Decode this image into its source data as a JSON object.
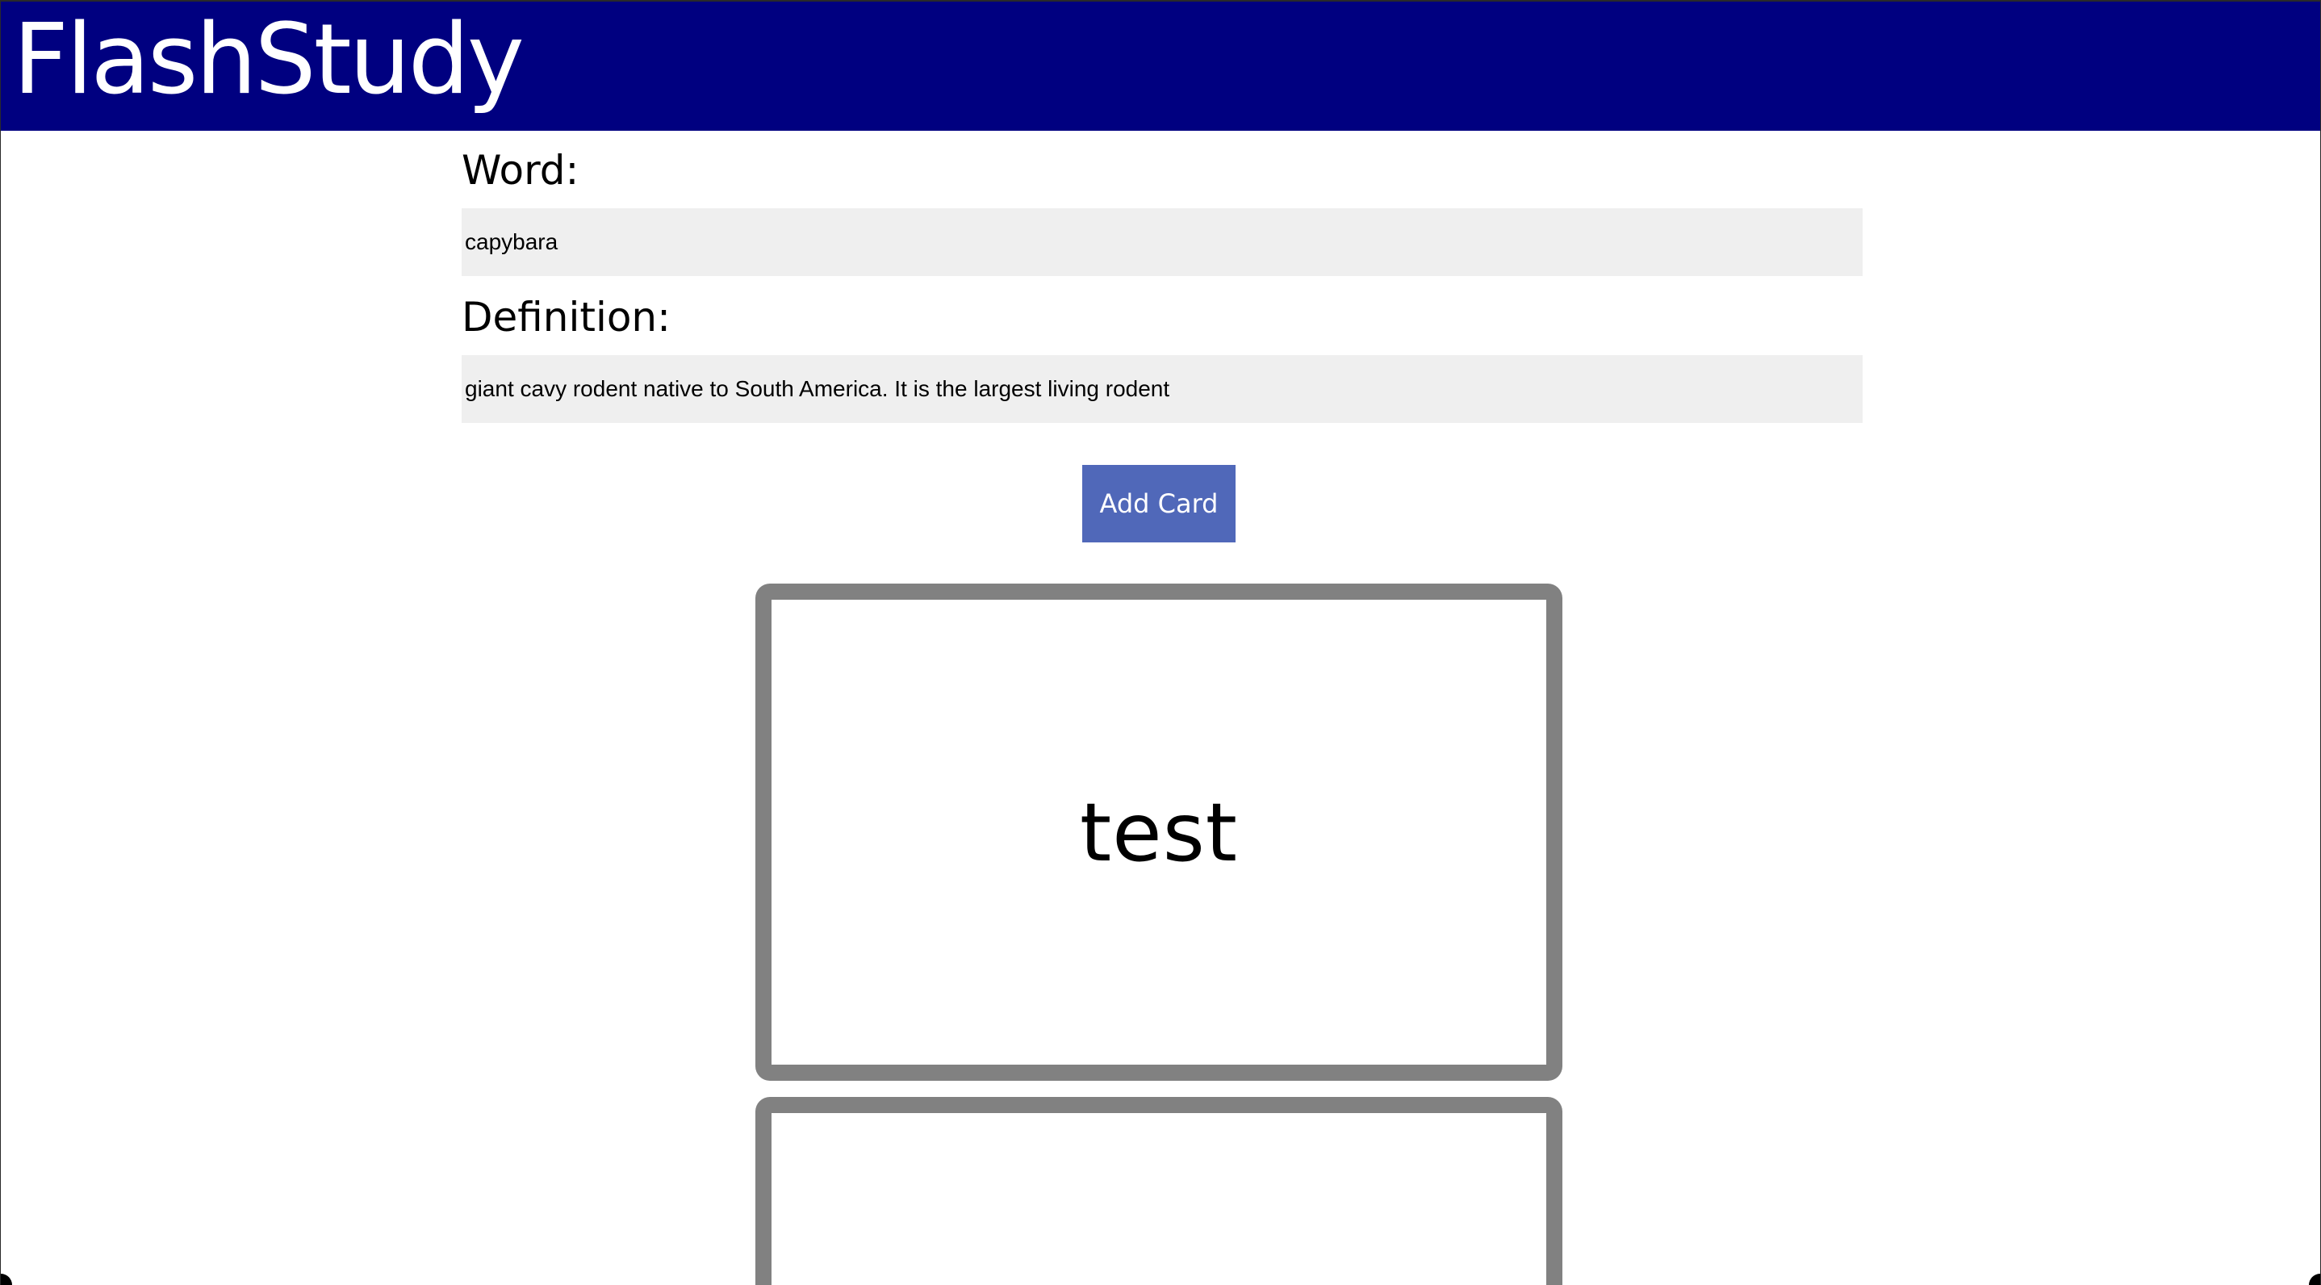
{
  "app": {
    "title": "FlashStudy"
  },
  "form": {
    "word_label": "Word:",
    "word_value": "capybara",
    "definition_label": "Definition:",
    "definition_value": "giant cavy rodent native to South America. It is the largest living rodent",
    "add_button_label": "Add Card"
  },
  "cards": [
    {
      "word": "test"
    },
    {
      "word": ""
    }
  ],
  "colors": {
    "header_bg": "#000080",
    "button_bg": "#5068b9",
    "card_border": "#818181",
    "input_bg": "#efefef"
  }
}
